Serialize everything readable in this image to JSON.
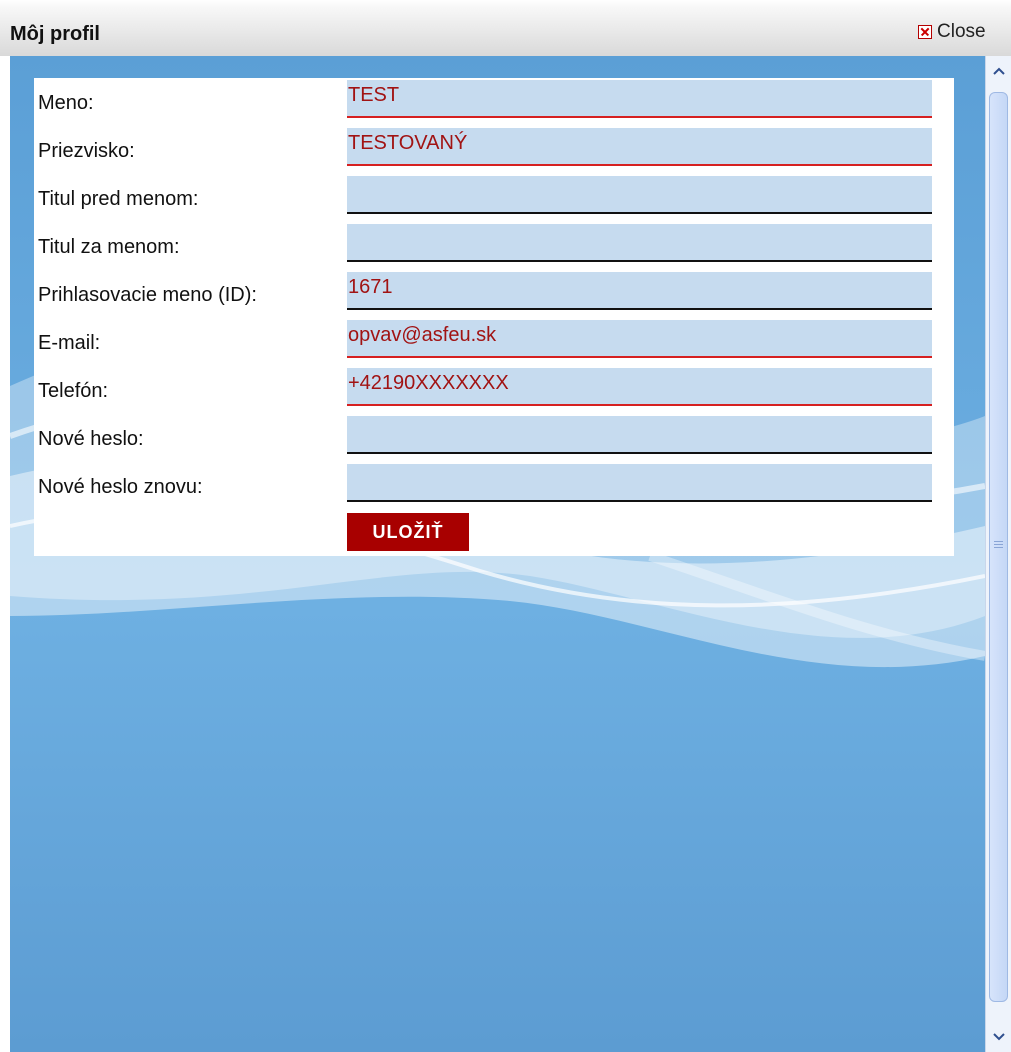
{
  "window": {
    "title": "Môj profil",
    "close_label": "Close"
  },
  "form": {
    "rows": [
      {
        "label": "Meno:",
        "value": "TEST"
      },
      {
        "label": "Priezvisko:",
        "value": "TESTOVANÝ"
      },
      {
        "label": "Titul pred menom:",
        "value": ""
      },
      {
        "label": "Titul za menom:",
        "value": ""
      },
      {
        "label": "Prihlasovacie meno (ID):",
        "value": "1671"
      },
      {
        "label": "E-mail:",
        "value": "opvav@asfeu.sk"
      },
      {
        "label": "Telefón:",
        "value": "+42190XXXXXXX"
      },
      {
        "label": "Nové heslo:",
        "value": ""
      },
      {
        "label": "Nové heslo znovu:",
        "value": ""
      }
    ],
    "save_label": "ULOŽIŤ"
  },
  "colors": {
    "field_bg": "#c6dbef",
    "field_text": "#a11313",
    "required_underline": "#d62020",
    "button_bg": "#a80000",
    "background_blue": "#6eb0e2"
  }
}
